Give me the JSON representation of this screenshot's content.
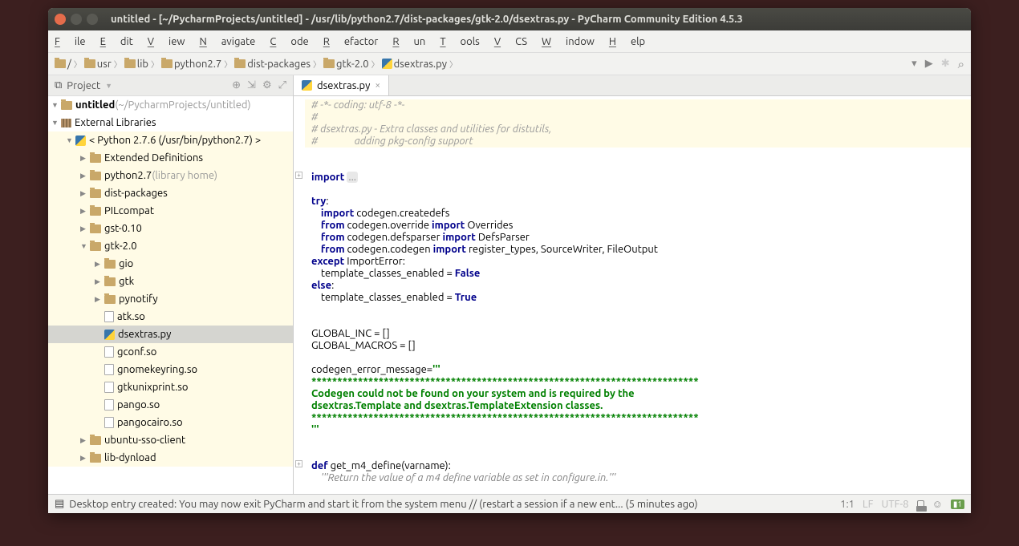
{
  "titlebar": {
    "title": "untitled - [~/PycharmProjects/untitled] - /usr/lib/python2.7/dist-packages/gtk-2.0/dsextras.py - PyCharm Community Edition 4.5.3"
  },
  "menu": {
    "items": [
      "File",
      "Edit",
      "View",
      "Navigate",
      "Code",
      "Refactor",
      "Run",
      "Tools",
      "VCS",
      "Window",
      "Help"
    ]
  },
  "breadcrumbs": {
    "items": [
      {
        "icon": "folder",
        "label": "/"
      },
      {
        "icon": "folder",
        "label": "usr"
      },
      {
        "icon": "folder",
        "label": "lib"
      },
      {
        "icon": "folder",
        "label": "python2.7"
      },
      {
        "icon": "folder",
        "label": "dist-packages"
      },
      {
        "icon": "folder",
        "label": "gtk-2.0"
      },
      {
        "icon": "py",
        "label": "dsextras.py"
      }
    ]
  },
  "sidebar": {
    "title": "Project",
    "tree": [
      {
        "depth": 0,
        "disc": "down",
        "icon": "folder",
        "label": "untitled",
        "suffix": " (~/PycharmProjects/untitled)",
        "bold": true
      },
      {
        "depth": 0,
        "disc": "down",
        "icon": "lib",
        "label": "External Libraries"
      },
      {
        "depth": 1,
        "disc": "down",
        "icon": "py",
        "label": "< Python 2.7.6 (/usr/bin/python2.7) >",
        "hl": true
      },
      {
        "depth": 2,
        "disc": "right",
        "icon": "folder",
        "label": "Extended Definitions",
        "hl": true
      },
      {
        "depth": 2,
        "disc": "right",
        "icon": "folder",
        "label": "python2.7",
        "suffix": " (library home)",
        "hl": true
      },
      {
        "depth": 2,
        "disc": "right",
        "icon": "folder",
        "label": "dist-packages",
        "hl": true
      },
      {
        "depth": 2,
        "disc": "right",
        "icon": "folder",
        "label": "PILcompat",
        "hl": true
      },
      {
        "depth": 2,
        "disc": "right",
        "icon": "folder",
        "label": "gst-0.10",
        "hl": true
      },
      {
        "depth": 2,
        "disc": "down",
        "icon": "folder",
        "label": "gtk-2.0",
        "hl": true
      },
      {
        "depth": 3,
        "disc": "right",
        "icon": "folder",
        "label": "gio",
        "hl": true
      },
      {
        "depth": 3,
        "disc": "right",
        "icon": "folder",
        "label": "gtk",
        "hl": true
      },
      {
        "depth": 3,
        "disc": "right",
        "icon": "folder",
        "label": "pynotify",
        "hl": true
      },
      {
        "depth": 3,
        "disc": "",
        "icon": "file",
        "label": "atk.so",
        "hl": true
      },
      {
        "depth": 3,
        "disc": "",
        "icon": "py",
        "label": "dsextras.py",
        "sel": true
      },
      {
        "depth": 3,
        "disc": "",
        "icon": "file",
        "label": "gconf.so",
        "hl": true
      },
      {
        "depth": 3,
        "disc": "",
        "icon": "file",
        "label": "gnomekeyring.so",
        "hl": true
      },
      {
        "depth": 3,
        "disc": "",
        "icon": "file",
        "label": "gtkunixprint.so",
        "hl": true
      },
      {
        "depth": 3,
        "disc": "",
        "icon": "file",
        "label": "pango.so",
        "hl": true
      },
      {
        "depth": 3,
        "disc": "",
        "icon": "file",
        "label": "pangocairo.so",
        "hl": true
      },
      {
        "depth": 2,
        "disc": "right",
        "icon": "folder",
        "label": "ubuntu-sso-client",
        "hl": true
      },
      {
        "depth": 2,
        "disc": "right",
        "icon": "folder",
        "label": "lib-dynload",
        "hl": true
      }
    ]
  },
  "editor": {
    "tab_label": "dsextras.py",
    "lines": [
      {
        "cls": "comment-bg",
        "html": "<span class='c-comment'># -*- coding: utf-8 -*-</span>"
      },
      {
        "cls": "comment-bg",
        "html": "<span class='c-comment'>#</span>"
      },
      {
        "cls": "comment-bg",
        "html": "<span class='c-comment'># dsextras.py - Extra classes and utilities for distutils,</span>"
      },
      {
        "cls": "comment-bg",
        "html": "<span class='c-comment'>#               adding pkg-config support</span>"
      },
      {
        "cls": "",
        "html": ""
      },
      {
        "cls": "",
        "html": ""
      },
      {
        "cls": "",
        "html": "<span class='c-kw'>import</span> <span class='c-ellip'>...</span>",
        "fold": true
      },
      {
        "cls": "",
        "html": ""
      },
      {
        "cls": "",
        "html": "<span class='c-kw'>try</span>:"
      },
      {
        "cls": "",
        "html": "    <span class='c-kw'>import</span> codegen.createdefs"
      },
      {
        "cls": "",
        "html": "    <span class='c-kw'>from</span> codegen.override <span class='c-kw'>import</span> Overrides"
      },
      {
        "cls": "",
        "html": "    <span class='c-kw'>from</span> codegen.defsparser <span class='c-kw'>import</span> DefsParser"
      },
      {
        "cls": "",
        "html": "    <span class='c-kw'>from</span> codegen.codegen <span class='c-kw'>import</span> register_types, SourceWriter, FileOutput"
      },
      {
        "cls": "",
        "html": "<span class='c-kw'>except</span> ImportError:"
      },
      {
        "cls": "",
        "html": "    template_classes_enabled = <span class='c-kw'>False</span>"
      },
      {
        "cls": "",
        "html": "<span class='c-kw'>else</span>:"
      },
      {
        "cls": "",
        "html": "    template_classes_enabled = <span class='c-kw'>True</span>"
      },
      {
        "cls": "",
        "html": ""
      },
      {
        "cls": "",
        "html": ""
      },
      {
        "cls": "",
        "html": "GLOBAL_INC = []"
      },
      {
        "cls": "",
        "html": "GLOBAL_MACROS = []"
      },
      {
        "cls": "",
        "html": ""
      },
      {
        "cls": "",
        "html": "codegen_error_message=<span class='c-str'>'''</span>"
      },
      {
        "cls": "",
        "html": "<span class='c-str'>***************************************************************************</span>"
      },
      {
        "cls": "",
        "html": "<span class='c-str'>Codegen could not be found on your system and is required by the</span>"
      },
      {
        "cls": "",
        "html": "<span class='c-str'>dsextras.Template and dsextras.TemplateExtension classes.</span>"
      },
      {
        "cls": "",
        "html": "<span class='c-str'>***************************************************************************</span>"
      },
      {
        "cls": "",
        "html": "<span class='c-str'>'''</span>"
      },
      {
        "cls": "",
        "html": ""
      },
      {
        "cls": "",
        "html": ""
      },
      {
        "cls": "",
        "html": "<span class='c-kw'>def</span> get_m4_define(varname):",
        "fold": true
      },
      {
        "cls": "",
        "html": "    <span class='c-doc'>'''Return the value of a m4 define variable as set in configure.in.'''</span>"
      }
    ]
  },
  "statusbar": {
    "msg": "Desktop entry created: You may now exit PyCharm and start it from the system menu // (restart a session if a new ent... (5 minutes ago)",
    "pos": "1:1",
    "enc1": "LF",
    "enc2": "UTF-8"
  }
}
